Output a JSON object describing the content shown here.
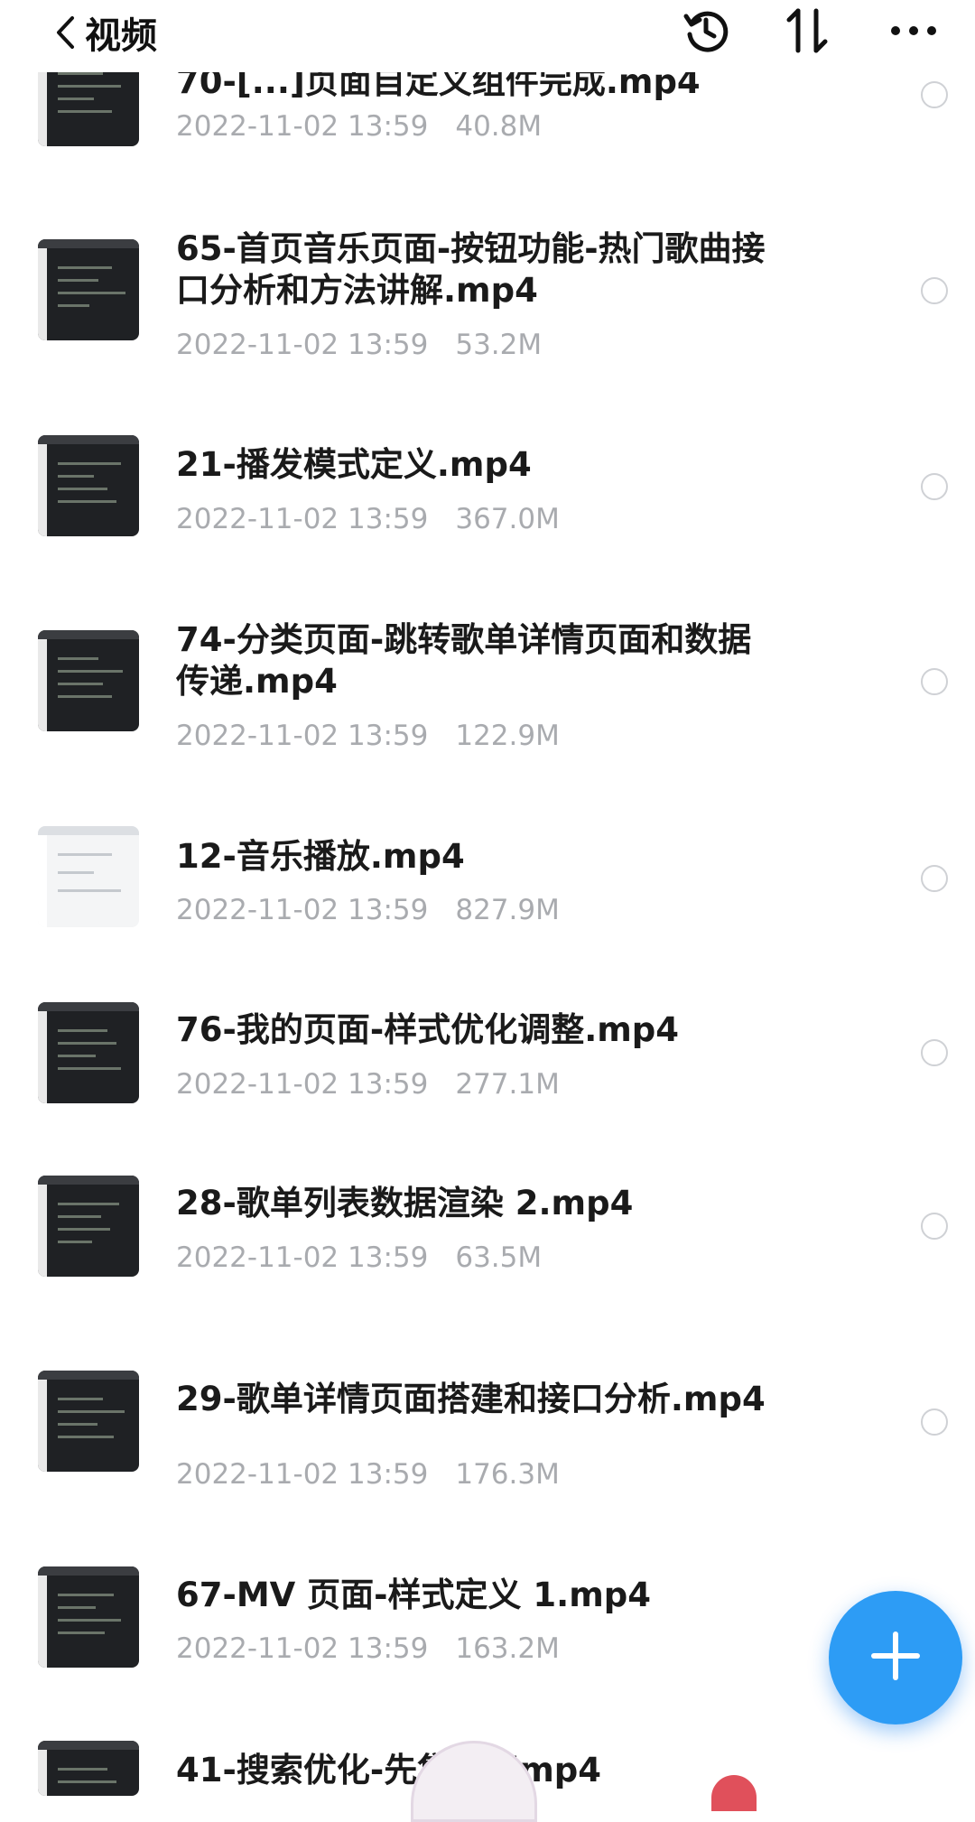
{
  "header": {
    "title": "视频",
    "back_icon": "chevron-left-icon",
    "history_icon": "history-icon",
    "sort_icon": "sort-icon",
    "more_icon": "more-horizontal-icon"
  },
  "files": [
    {
      "name": "70-[...]页面自定义组件完成.mp4",
      "date": "2022-11-02 13:59",
      "size": "40.8M",
      "thumb": "dark"
    },
    {
      "name": "65-首页音乐页面-按钮功能-热门歌曲接\n口分析和方法讲解.mp4",
      "date": "2022-11-02 13:59",
      "size": "53.2M",
      "thumb": "dark"
    },
    {
      "name": "21-播发模式定义.mp4",
      "date": "2022-11-02 13:59",
      "size": "367.0M",
      "thumb": "dark"
    },
    {
      "name": "74-分类页面-跳转歌单详情页面和数据\n传递.mp4",
      "date": "2022-11-02 13:59",
      "size": "122.9M",
      "thumb": "dark"
    },
    {
      "name": "12-音乐播放.mp4",
      "date": "2022-11-02 13:59",
      "size": "827.9M",
      "thumb": "light"
    },
    {
      "name": "76-我的页面-样式优化调整.mp4",
      "date": "2022-11-02 13:59",
      "size": "277.1M",
      "thumb": "dark"
    },
    {
      "name": "28-歌单列表数据渲染 2.mp4",
      "date": "2022-11-02 13:59",
      "size": "63.5M",
      "thumb": "dark"
    },
    {
      "name": "29-歌单详情页面搭建和接口分析.mp4",
      "date": "2022-11-02 13:59",
      "size": "176.3M",
      "thumb": "dark"
    },
    {
      "name": "67-MV 页面-样式定义 1.mp4",
      "date": "2022-11-02 13:59",
      "size": "163.2M",
      "thumb": "dark"
    },
    {
      "name": "41-搜索优化-先集[...]mp4",
      "date": "",
      "size": "",
      "thumb": "dark"
    }
  ],
  "fab": {
    "icon": "plus-icon",
    "color": "#2d9cf5"
  }
}
